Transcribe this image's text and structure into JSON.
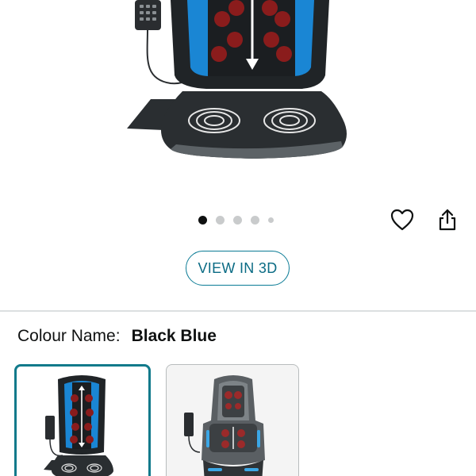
{
  "product_gallery": {
    "image_alt": "Shiatsu massage seat cushion with handheld controller",
    "dots_count": 5,
    "active_index": 0,
    "image_count": 5
  },
  "actions": {
    "wishlist_icon": "heart-icon",
    "share_icon": "share-icon"
  },
  "view_3d_label": "VIEW IN 3D",
  "variation": {
    "label": "Colour Name:",
    "selected": "Black Blue",
    "swatches": [
      {
        "name": "Black Blue",
        "selected": true
      },
      {
        "name": "Grey",
        "selected": false
      }
    ]
  },
  "colors": {
    "accent": "#117a8b",
    "button_text": "#0a6b84",
    "cushion_blue": "#1a86d4",
    "cushion_dark": "#1f2326"
  }
}
